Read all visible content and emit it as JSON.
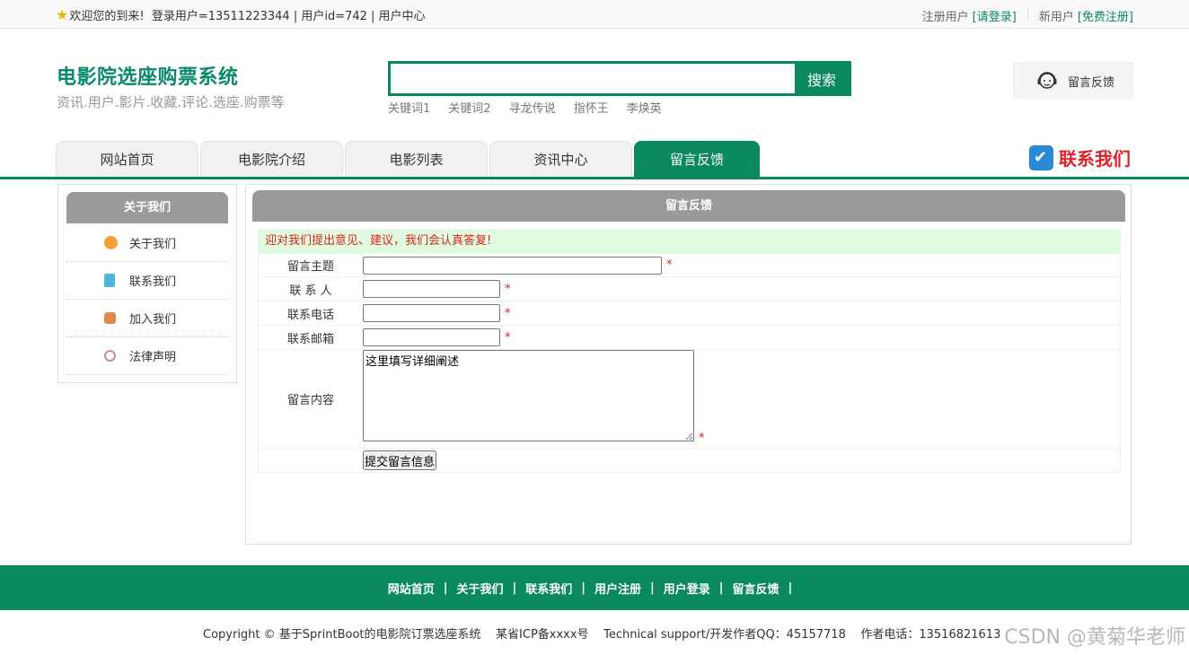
{
  "topbar": {
    "welcome": "欢迎您的到来!  登录用户=13511223344 | 用户id=742 | 用户中心",
    "registered_user": "注册用户",
    "login_link": "[请登录]",
    "new_user": "新用户",
    "register_link": "[免费注册]"
  },
  "brand": {
    "title": "电影院选座购票系统",
    "subtitle": "资讯.用户.影片.收藏.评论.选座.购票等"
  },
  "search": {
    "button": "搜索",
    "value": "",
    "hotwords": [
      "关键词1",
      "关键词2",
      "寻龙传说",
      "指怀王",
      "李焕英"
    ]
  },
  "feedback_box": {
    "label": "留言反馈"
  },
  "nav": {
    "tabs": [
      "网站首页",
      "电影院介绍",
      "电影列表",
      "资讯中心",
      "留言反馈"
    ],
    "active": "留言反馈",
    "contact": "联系我们"
  },
  "sidebar": {
    "title": "关于我们",
    "items": [
      {
        "label": "关于我们",
        "icon": "info-icon",
        "color": "#f5a033"
      },
      {
        "label": "联系我们",
        "icon": "clipboard-icon",
        "color": "#4fb6d8"
      },
      {
        "label": "加入我们",
        "icon": "lock-icon",
        "color": "#e08a4e"
      },
      {
        "label": "法律声明",
        "icon": "power-icon",
        "color": "#c88a8a"
      }
    ]
  },
  "main": {
    "title": "留言反馈",
    "notice": "迎对我们提出意见、建议，我们会认真答复!",
    "fields": {
      "subject_label": "留言主题",
      "contact_label": "联 系 人",
      "phone_label": "联系电话",
      "email_label": "联系邮箱",
      "content_label": "留言内容",
      "content_placeholder": "这里填写详细阐述",
      "required_mark": "*"
    },
    "submit": "提交留言信息"
  },
  "footer": {
    "links": [
      "网站首页",
      "关于我们",
      "联系我们",
      "用户注册",
      "用户登录",
      "留言反馈"
    ],
    "copyright": "Copyright © 基于SprintBoot的电影院订票选座系统    某省ICP备xxxx号    Technical support/开发作者QQ：45157718    作者电话：13516821613"
  },
  "watermark": "CSDN @黄菊华老师",
  "colors": {
    "brand_green": "#0a8a5c",
    "title_teal": "#0a8a6c",
    "red": "#e02020",
    "notice_bg": "#e0fce0"
  }
}
